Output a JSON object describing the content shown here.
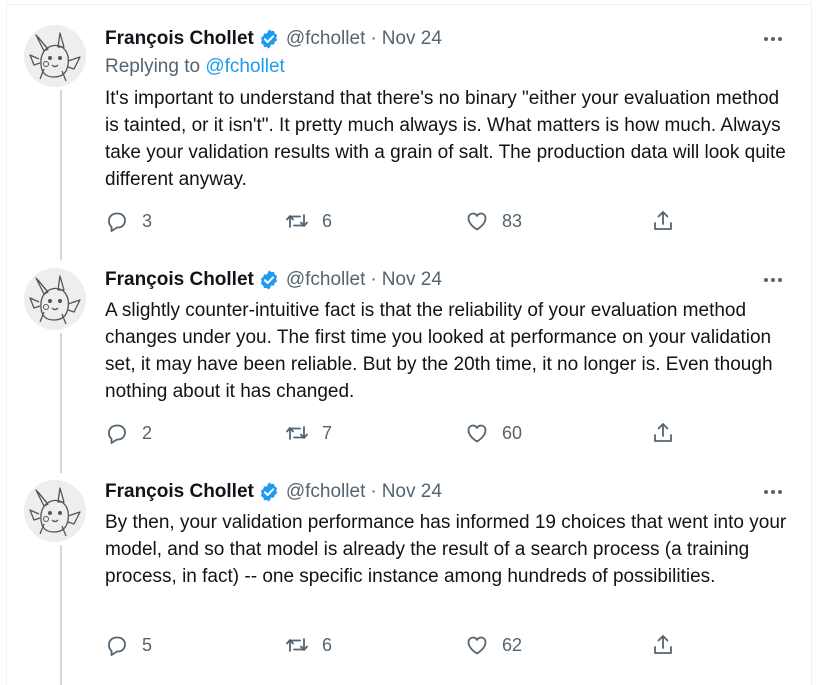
{
  "tweets": [
    {
      "author": "François Chollet",
      "handle": "@fchollet",
      "separator": "·",
      "date": "Nov 24",
      "replying_prefix": "Replying to ",
      "replying_to": "@fchollet",
      "text": "It's important to understand that there's no binary \"either your evaluation method is tainted, or it isn't\". It pretty much always is. What matters is how much. Always take your validation results with a grain of salt. The production data will look quite different anyway.",
      "replies": "3",
      "retweets": "6",
      "likes": "83"
    },
    {
      "author": "François Chollet",
      "handle": "@fchollet",
      "separator": "·",
      "date": "Nov 24",
      "text": "A slightly counter-intuitive fact is that the reliability of your evaluation method changes under you. The first time you looked at performance on your validation set, it may have been reliable. But by the 20th time, it no longer is. Even though nothing about it has changed.",
      "replies": "2",
      "retweets": "7",
      "likes": "60"
    },
    {
      "author": "François Chollet",
      "handle": "@fchollet",
      "separator": "·",
      "date": "Nov 24",
      "text": "By then, your validation performance has informed 19 choices that went into your model, and so that model is already the result of a search process (a training process, in fact) -- one specific instance among hundreds of possibilities.",
      "replies": "5",
      "retweets": "6",
      "likes": "62"
    }
  ],
  "icons": {
    "verified": "verified-badge-icon",
    "more": "more-horizontal-icon",
    "reply": "reply-bubble-icon",
    "retweet": "retweet-icon",
    "like": "heart-icon",
    "share": "share-icon",
    "avatar": "pikachu-sketch-avatar"
  },
  "colors": {
    "text_primary": "#0f1419",
    "text_secondary": "#536471",
    "accent": "#1d9bf0",
    "thread_line": "#cfd9de"
  }
}
